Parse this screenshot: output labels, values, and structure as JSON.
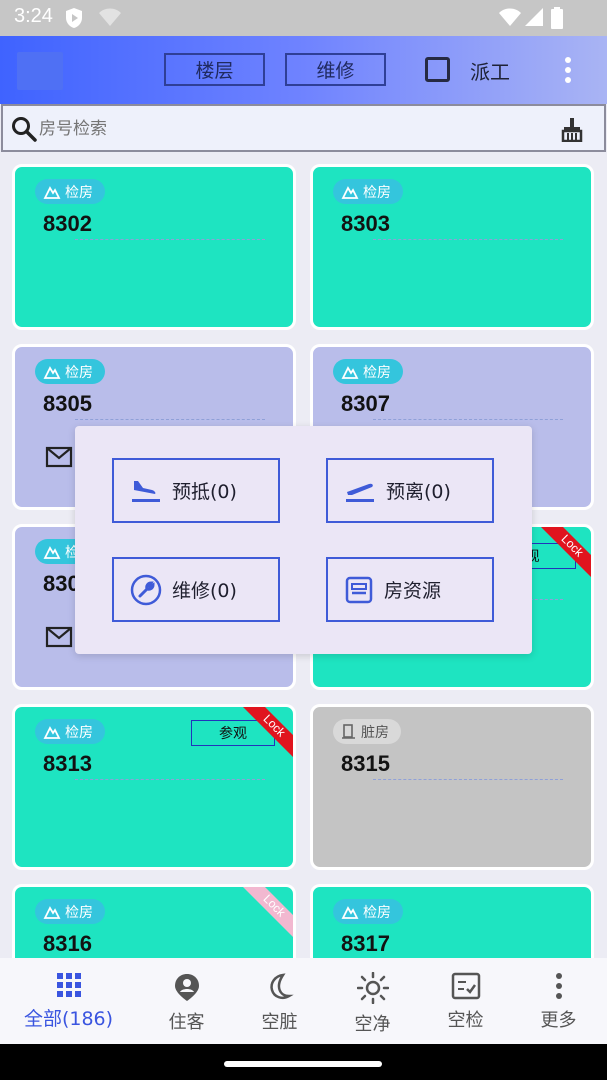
{
  "status_bar": {
    "time": "3:24"
  },
  "app_bar": {
    "floor_tab": "楼层",
    "repair_tab": "维修",
    "dispatch_label": "派工",
    "dispatch_checked": false
  },
  "search": {
    "placeholder": "房号检索",
    "value": ""
  },
  "rooms": [
    {
      "number": "8302",
      "status": "检房",
      "color": "green"
    },
    {
      "number": "8303",
      "status": "检房",
      "color": "green"
    },
    {
      "number": "8305",
      "status": "检房",
      "color": "purple"
    },
    {
      "number": "8307",
      "status": "检房",
      "color": "purple"
    },
    {
      "number": "830",
      "status": "检",
      "color": "purple"
    },
    {
      "number": "",
      "status": "",
      "color": "green",
      "tag": "观",
      "ribbon": "Lock"
    },
    {
      "number": "8313",
      "status": "检房",
      "color": "green",
      "tag": "参观",
      "ribbon": "Lock"
    },
    {
      "number": "8315",
      "status": "脏房",
      "color": "gray"
    },
    {
      "number": "8316",
      "status": "检房",
      "color": "green",
      "ribbon": "Lock"
    },
    {
      "number": "8317",
      "status": "检房",
      "color": "green"
    }
  ],
  "popup": {
    "arrival": "预抵(0)",
    "departure": "预离(0)",
    "repair": "维修(0)",
    "room_resource": "房资源"
  },
  "bottom_nav": [
    {
      "label": "全部(186)",
      "icon": "grid-icon",
      "active": true
    },
    {
      "label": "住客",
      "icon": "guest-icon",
      "active": false
    },
    {
      "label": "空脏",
      "icon": "moon-icon",
      "active": false
    },
    {
      "label": "空净",
      "icon": "sun-icon",
      "active": false
    },
    {
      "label": "空检",
      "icon": "checklist-icon",
      "active": false
    },
    {
      "label": "更多",
      "icon": "more-icon",
      "active": false
    }
  ],
  "colors": {
    "card_green": "#1ee4c1",
    "card_purple": "#b9bdea",
    "card_gray": "#c4c4c4",
    "accent": "#3a55e0",
    "lock_red": "#e0141e",
    "lock_pink": "#f2b8d0"
  }
}
